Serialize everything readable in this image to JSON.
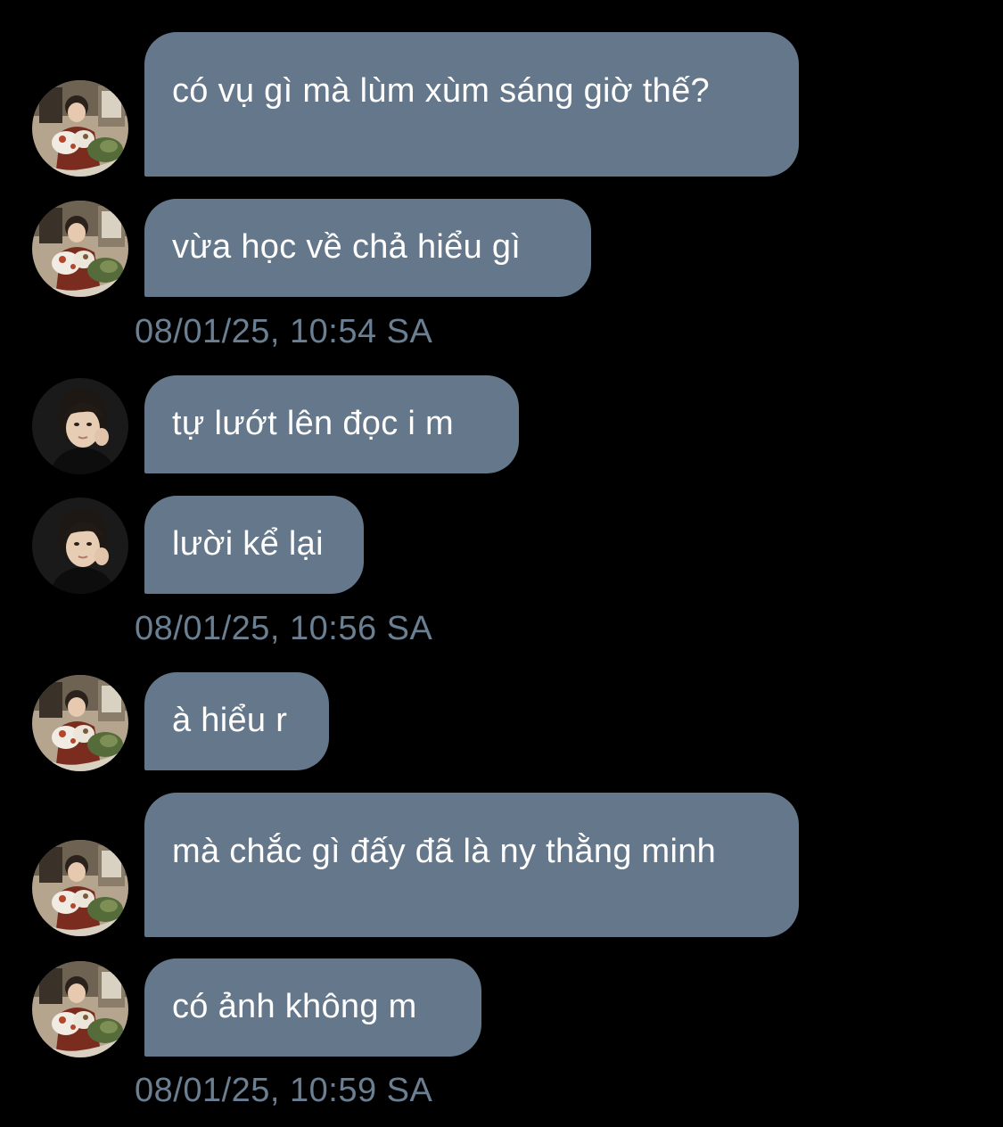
{
  "messages": [
    {
      "text": "có vụ gì mà lùm xùm sáng giờ thế?",
      "sender": "friend-a"
    },
    {
      "text": "vừa học về chả hiểu gì",
      "sender": "friend-a"
    },
    {
      "text": "tự lướt lên đọc i m",
      "sender": "friend-b"
    },
    {
      "text": "lười kể lại",
      "sender": "friend-b"
    },
    {
      "text": "à hiểu r",
      "sender": "friend-a"
    },
    {
      "text": "mà chắc gì đấy đã là ny thằng minh",
      "sender": "friend-a"
    },
    {
      "text": "có ảnh không m",
      "sender": "friend-a"
    }
  ],
  "timestamps": [
    "08/01/25, 10:54 SA",
    "08/01/25, 10:56 SA",
    "08/01/25, 10:59 SA"
  ],
  "colors": {
    "background": "#000000",
    "bubble": "#65778a",
    "bubble_text": "#ffffff",
    "timestamp": "#6b7f93"
  },
  "icons": {
    "friend_a_avatar": "avatar-photo-friend-a",
    "friend_b_avatar": "avatar-photo-friend-b"
  }
}
